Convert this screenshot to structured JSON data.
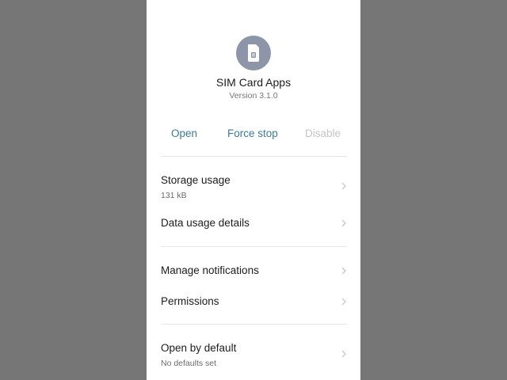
{
  "app": {
    "name": "SIM Card Apps",
    "version": "Version 3.1.0",
    "icon": "sim-card-icon",
    "icon_bg": "#8c96a8"
  },
  "actions": {
    "open": "Open",
    "force_stop": "Force stop",
    "disable": "Disable"
  },
  "settings": {
    "storage": {
      "title": "Storage usage",
      "value": "131 kB"
    },
    "data_usage": {
      "title": "Data usage details"
    },
    "notifications": {
      "title": "Manage notifications"
    },
    "permissions": {
      "title": "Permissions"
    },
    "open_default": {
      "title": "Open by default",
      "value": "No defaults set"
    }
  },
  "colors": {
    "accent": "#3c7a96",
    "disabled": "#c4c4c4",
    "overlay": "#767676"
  }
}
